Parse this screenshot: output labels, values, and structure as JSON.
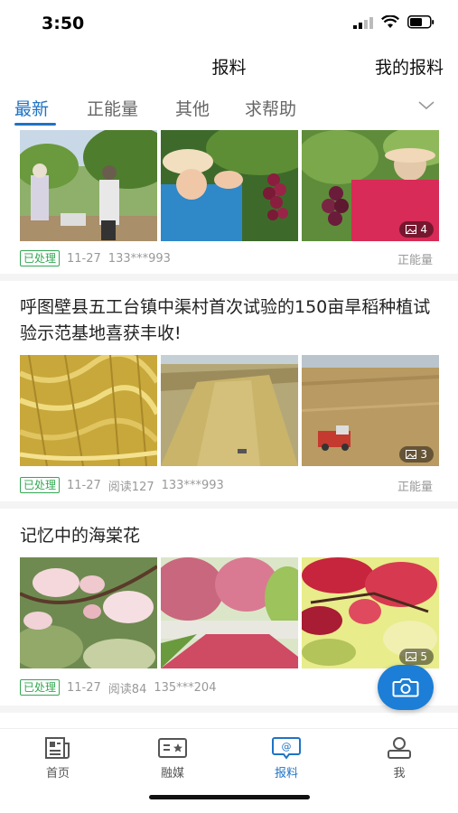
{
  "status_bar": {
    "time": "3:50"
  },
  "header": {
    "title": "报料",
    "right_link": "我的报料"
  },
  "tabs": [
    {
      "label": "最新",
      "active": true
    },
    {
      "label": "正能量",
      "active": false
    },
    {
      "label": "其他",
      "active": false
    },
    {
      "label": "求帮助",
      "active": false
    }
  ],
  "posts": [
    {
      "title": "",
      "image_count": "4",
      "status": "已处理",
      "date": "11-27",
      "reads": "",
      "user": "133***993",
      "category": "正能量"
    },
    {
      "title": "呼图壁县五工台镇中渠村首次试验的150亩旱稻种植试验示范基地喜获丰收!",
      "image_count": "3",
      "status": "已处理",
      "date": "11-27",
      "reads": "阅读127",
      "user": "133***993",
      "category": "正能量"
    },
    {
      "title": "记忆中的海棠花",
      "image_count": "5",
      "status": "已处理",
      "date": "11-27",
      "reads": "阅读84",
      "user": "135***204",
      "category": ""
    }
  ],
  "bottom_nav": [
    {
      "label": "首页",
      "icon": "home-news-icon",
      "active": false
    },
    {
      "label": "融媒",
      "icon": "media-icon",
      "active": false
    },
    {
      "label": "报料",
      "icon": "report-icon",
      "active": true
    },
    {
      "label": "我",
      "icon": "profile-icon",
      "active": false
    }
  ],
  "colors": {
    "accent": "#1f73c4",
    "fab": "#1c7ed6",
    "status_tag": "#33a853"
  }
}
